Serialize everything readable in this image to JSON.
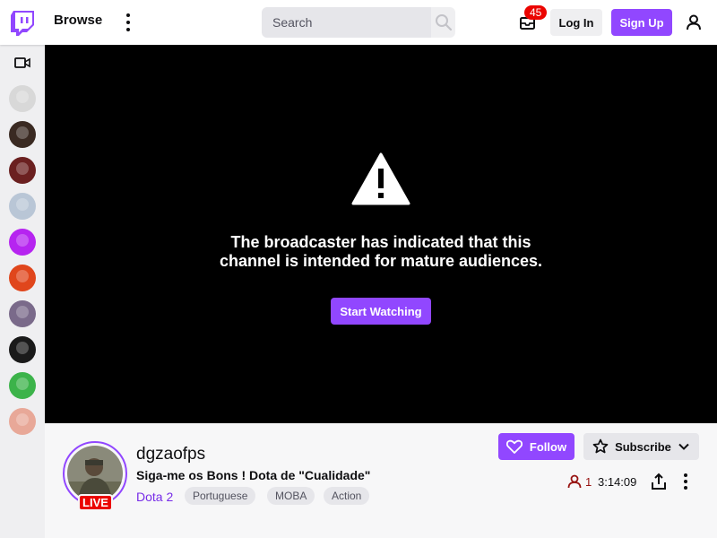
{
  "nav": {
    "browse_label": "Browse",
    "search_placeholder": "Search",
    "inbox_count": "45",
    "login_label": "Log In",
    "signup_label": "Sign Up",
    "brand_color": "#9147ff"
  },
  "sidebar": {
    "icon": "video-camera-icon",
    "avatars": [
      {
        "name": "avatar-1",
        "color": "#d8d8d8"
      },
      {
        "name": "avatar-2",
        "color": "#3a2a22"
      },
      {
        "name": "avatar-3",
        "color": "#6b2020"
      },
      {
        "name": "avatar-4",
        "color": "#b9c6d6"
      },
      {
        "name": "avatar-5",
        "color": "#b624f0"
      },
      {
        "name": "avatar-6",
        "color": "#e0461c"
      },
      {
        "name": "avatar-7",
        "color": "#7a6a8a"
      },
      {
        "name": "avatar-8",
        "color": "#1a1a1a"
      },
      {
        "name": "avatar-9",
        "color": "#3cb34a"
      },
      {
        "name": "avatar-10",
        "color": "#e8a898"
      }
    ]
  },
  "player": {
    "mature_line1": "The broadcaster has indicated that this",
    "mature_line2": "channel is intended for mature audiences.",
    "start_label": "Start Watching"
  },
  "channel": {
    "name": "dgzaofps",
    "title": "Siga-me os Bons ! Dota de \"Cualidade\"",
    "game": "Dota 2",
    "live_label": "LIVE",
    "tags": [
      "Portuguese",
      "MOBA",
      "Action"
    ],
    "follow_label": "Follow",
    "subscribe_label": "Subscribe",
    "viewer_count": "1",
    "uptime": "3:14:09"
  }
}
